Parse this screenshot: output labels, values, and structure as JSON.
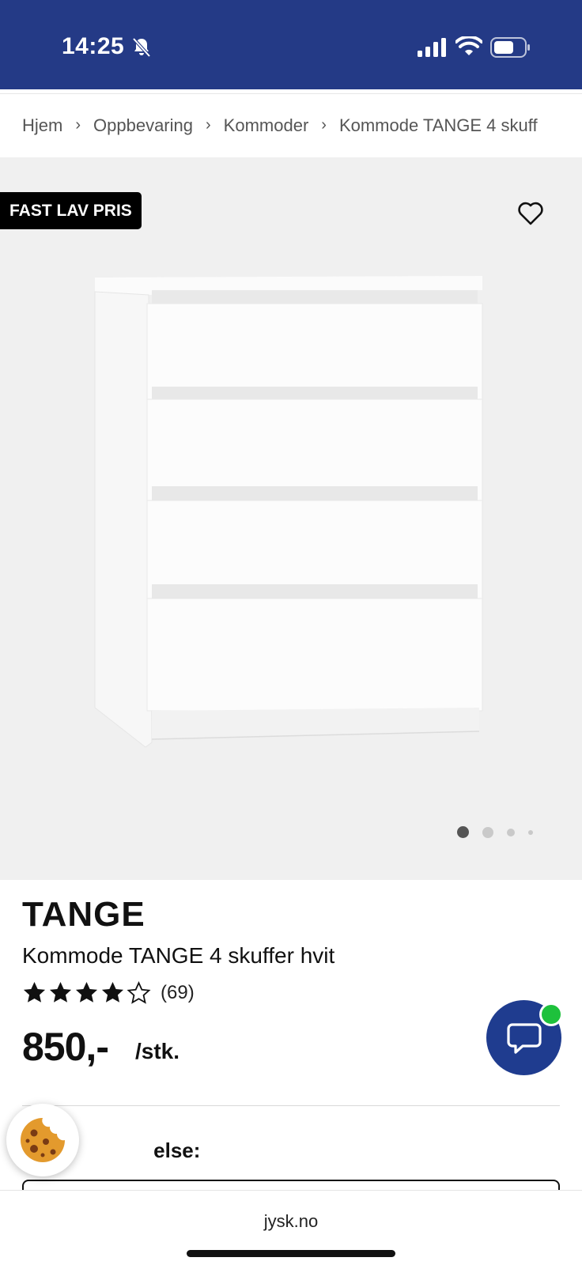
{
  "status_bar": {
    "time": "14:25"
  },
  "breadcrumb": [
    "Hjem",
    "Oppbevaring",
    "Kommoder",
    "Kommode TANGE 4 skuff"
  ],
  "gallery": {
    "badge": "FAST LAV PRIS",
    "image_count": 4,
    "active_image": 1
  },
  "product": {
    "brand": "TANGE",
    "name": "Kommode TANGE 4 skuffer hvit",
    "rating": 4,
    "rating_max": 5,
    "review_count": "(69)",
    "price": "850,-",
    "unit": "/stk."
  },
  "section_label": "else:",
  "browser": {
    "url": "jysk.no"
  },
  "colors": {
    "brand_blue": "#243a86",
    "chat_blue": "#1f3c8f",
    "online_green": "#1ec13c"
  },
  "icons": [
    "bell-off-icon",
    "signal-icon",
    "wifi-icon",
    "battery-icon",
    "heart-icon",
    "star-icon",
    "chat-icon",
    "cookie-icon"
  ]
}
